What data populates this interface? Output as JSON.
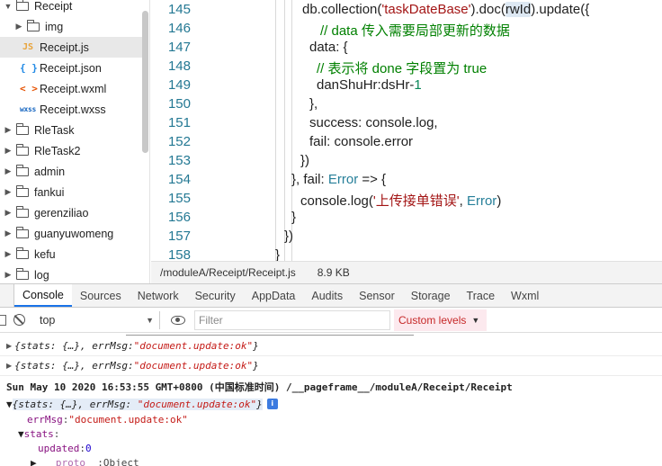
{
  "tree": {
    "items": [
      {
        "label": "Receipt",
        "kind": "folder",
        "expanded": true,
        "indent": 0
      },
      {
        "label": "img",
        "kind": "folder",
        "expanded": false,
        "indent": 1
      },
      {
        "label": "Receipt.js",
        "kind": "js",
        "icon": "JS",
        "indent": 1,
        "selected": true
      },
      {
        "label": "Receipt.json",
        "kind": "json",
        "icon": "{ }",
        "indent": 1
      },
      {
        "label": "Receipt.wxml",
        "kind": "wxml",
        "icon": "< >",
        "indent": 1
      },
      {
        "label": "Receipt.wxss",
        "kind": "wxss",
        "icon": "wxss",
        "indent": 1
      },
      {
        "label": "RleTask",
        "kind": "folder",
        "expanded": false,
        "indent": 0
      },
      {
        "label": "RleTask2",
        "kind": "folder",
        "expanded": false,
        "indent": 0
      },
      {
        "label": "admin",
        "kind": "folder",
        "expanded": false,
        "indent": 0
      },
      {
        "label": "fankui",
        "kind": "folder",
        "expanded": false,
        "indent": 0
      },
      {
        "label": "gerenziliao",
        "kind": "folder",
        "expanded": false,
        "indent": 0
      },
      {
        "label": "guanyuwomeng",
        "kind": "folder",
        "expanded": false,
        "indent": 0
      },
      {
        "label": "kefu",
        "kind": "folder",
        "expanded": false,
        "indent": 0
      },
      {
        "label": "log",
        "kind": "folder",
        "expanded": false,
        "indent": 0
      }
    ]
  },
  "editor": {
    "lines": [
      {
        "num": "145",
        "indent": 168,
        "tokens": [
          [
            "db.collection(",
            ""
          ],
          [
            "'taskDateBase'",
            "str"
          ],
          [
            ").doc(",
            ""
          ],
          [
            "rwId",
            "hl"
          ],
          [
            ").update({",
            ""
          ]
        ]
      },
      {
        "num": "146",
        "indent": 188,
        "tokens": [
          [
            "// data 传入需要局部更新的数据",
            "com"
          ]
        ]
      },
      {
        "num": "147",
        "indent": 176,
        "tokens": [
          [
            "data: {",
            ""
          ]
        ]
      },
      {
        "num": "148",
        "indent": 184,
        "tokens": [
          [
            "// 表示将 done 字段置为 true",
            "com"
          ]
        ]
      },
      {
        "num": "149",
        "indent": 184,
        "tokens": [
          [
            "danShuHr:dsHr-",
            ""
          ],
          [
            "1",
            "num"
          ]
        ]
      },
      {
        "num": "150",
        "indent": 176,
        "tokens": [
          [
            "},",
            ""
          ]
        ]
      },
      {
        "num": "151",
        "indent": 176,
        "tokens": [
          [
            "success: console.log,",
            ""
          ]
        ]
      },
      {
        "num": "152",
        "indent": 176,
        "tokens": [
          [
            "fail: console.error",
            ""
          ]
        ]
      },
      {
        "num": "153",
        "indent": 166,
        "tokens": [
          [
            "})",
            ""
          ]
        ]
      },
      {
        "num": "154",
        "indent": 156,
        "tokens": [
          [
            "}, fail: ",
            ""
          ],
          [
            "Error",
            "type"
          ],
          [
            " => {",
            ""
          ]
        ]
      },
      {
        "num": "155",
        "indent": 166,
        "tokens": [
          [
            "console.log(",
            ""
          ],
          [
            "'上传接单错误'",
            "str"
          ],
          [
            ", ",
            ""
          ],
          [
            "Error",
            "type"
          ],
          [
            ")",
            ""
          ]
        ]
      },
      {
        "num": "156",
        "indent": 156,
        "tokens": [
          [
            "}",
            ""
          ]
        ]
      },
      {
        "num": "157",
        "indent": 148,
        "tokens": [
          [
            "})",
            ""
          ]
        ]
      },
      {
        "num": "158",
        "indent": 138,
        "tokens": [
          [
            "}",
            ""
          ]
        ]
      }
    ]
  },
  "status": {
    "path": "/moduleA/Receipt/Receipt.js",
    "size": "8.9 KB"
  },
  "devtools": {
    "tabs": [
      "Console",
      "Sources",
      "Network",
      "Security",
      "AppData",
      "Audits",
      "Sensor",
      "Storage",
      "Trace",
      "Wxml"
    ],
    "active_tab": "Console"
  },
  "console_toolbar": {
    "context": "top",
    "filter_placeholder": "Filter",
    "levels": "Custom levels"
  },
  "console": {
    "msg1": {
      "obj": "{stats: {…}, errMsg: ",
      "val": "\"document.update:ok\"",
      "end": "}"
    },
    "msg2": {
      "obj": "{stats: {…}, errMsg: ",
      "val": "\"document.update:ok\"",
      "end": "}"
    },
    "timestamp": "Sun May 10 2020 16:53:55 GMT+0800 (中国标准时间) /__pageframe__/moduleA/Receipt/Receipt",
    "msg3": {
      "obj": "{stats: {…}, errMsg: ",
      "val": "\"document.update:ok\"",
      "end": "}",
      "badge": "i"
    },
    "expanded": {
      "errmsg_key": "errMsg",
      "errmsg_val": "\"document.update:ok\"",
      "stats_key": "stats",
      "updated_key": "updated",
      "updated_val": "0",
      "proto_key": "__proto__",
      "proto_val": "Object"
    }
  }
}
